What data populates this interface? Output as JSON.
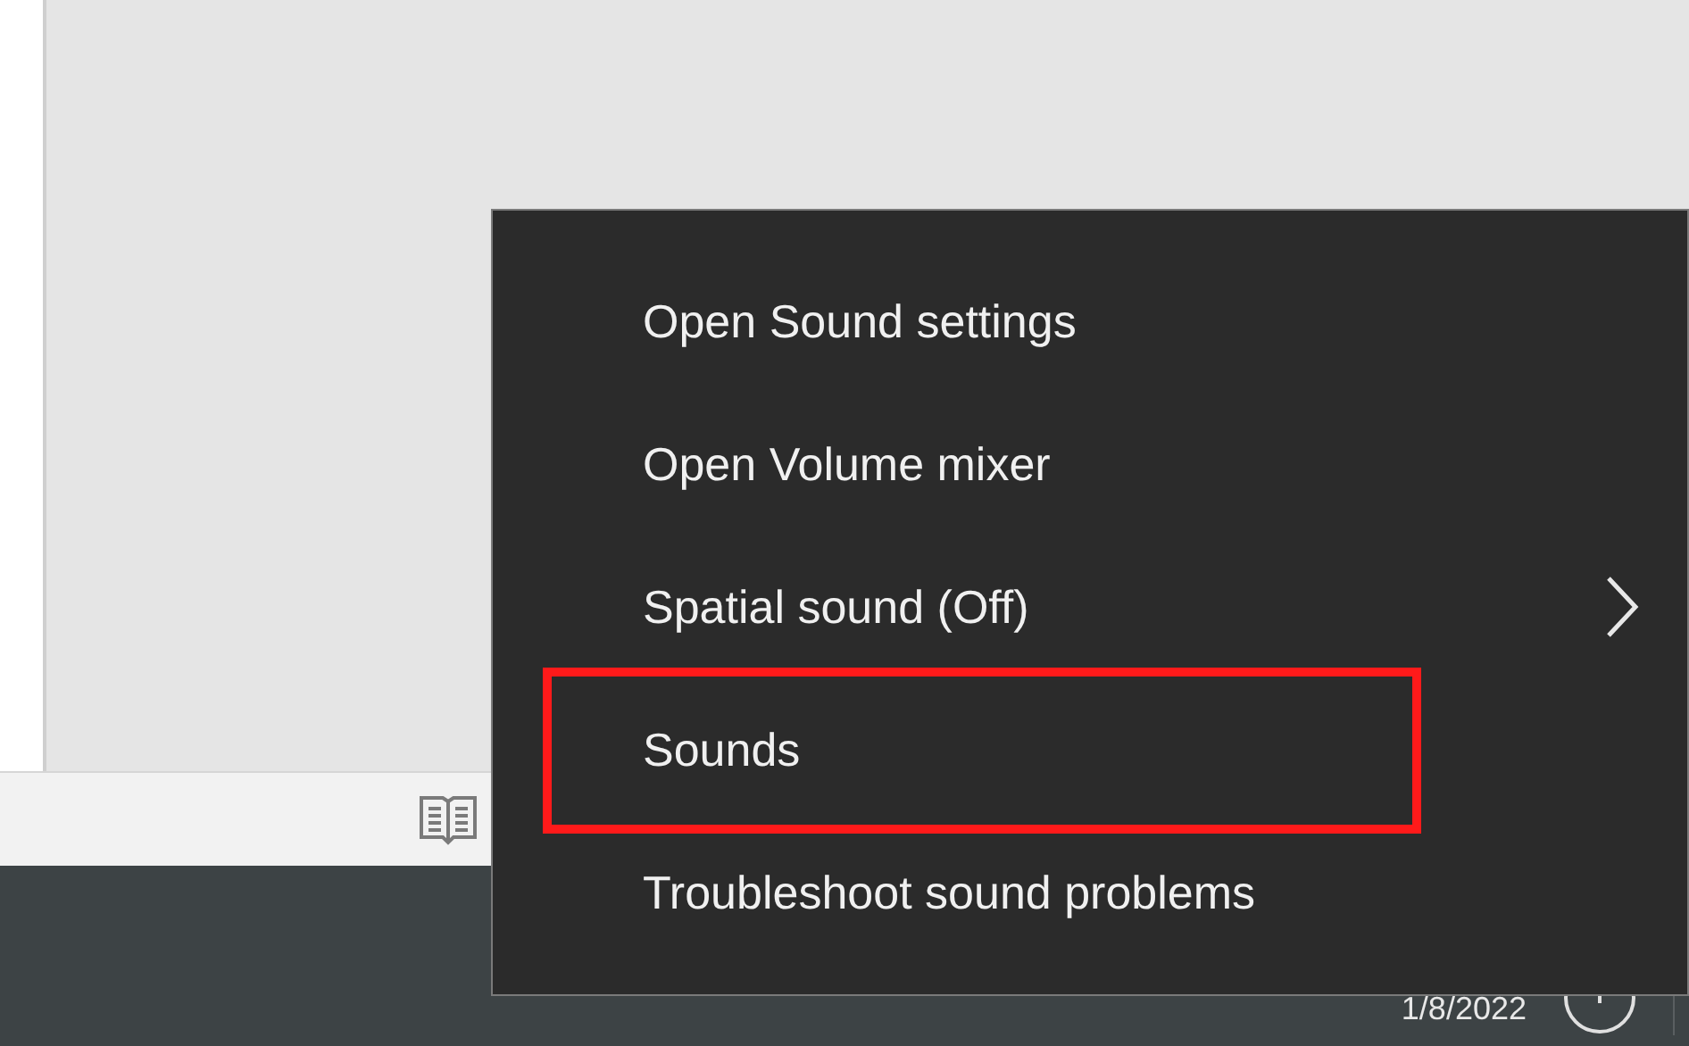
{
  "taskbar": {
    "date": "1/8/2022"
  },
  "context_menu": {
    "items": [
      {
        "label": "Open Sound settings",
        "kind": "action",
        "highlighted": false
      },
      {
        "label": "Open Volume mixer",
        "kind": "action",
        "highlighted": false
      },
      {
        "label": "Spatial sound (Off)",
        "kind": "submenu",
        "highlighted": false
      },
      {
        "label": "Sounds",
        "kind": "action",
        "highlighted": true
      },
      {
        "label": "Troubleshoot sound problems",
        "kind": "action",
        "highlighted": false
      }
    ]
  }
}
